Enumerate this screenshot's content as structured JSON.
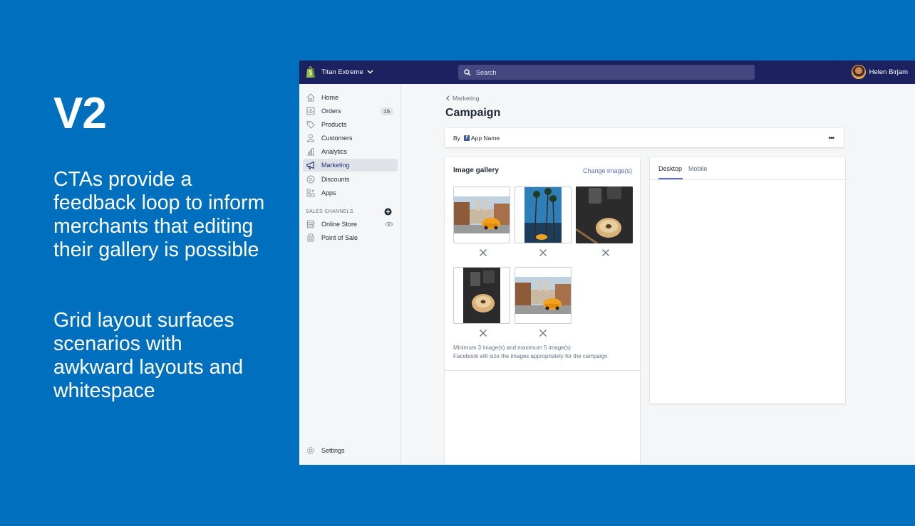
{
  "slide": {
    "title": "V2",
    "paragraph1": "CTAs provide a feedback loop to inform merchants that editing their gallery is possible",
    "paragraph2": "Grid layout surfaces scenarios with awkward layouts and whitespace",
    "background_color": "#0070BE"
  },
  "topbar": {
    "store_name": "Titan Extreme",
    "search_placeholder": "Search",
    "user_name": "Helen Birjam",
    "color": "#1C2260"
  },
  "sidebar": {
    "items": [
      {
        "label": "Home",
        "icon": "home-icon"
      },
      {
        "label": "Orders",
        "icon": "orders-icon",
        "badge": "15"
      },
      {
        "label": "Products",
        "icon": "tag-icon"
      },
      {
        "label": "Customers",
        "icon": "customer-icon"
      },
      {
        "label": "Analytics",
        "icon": "analytics-icon"
      },
      {
        "label": "Marketing",
        "icon": "megaphone-icon",
        "active": true
      },
      {
        "label": "Discounts",
        "icon": "discount-icon"
      },
      {
        "label": "Apps",
        "icon": "apps-icon"
      }
    ],
    "section_label": "SALES CHANNELS",
    "channels": [
      {
        "label": "Online Store",
        "icon": "store-icon"
      },
      {
        "label": "Point of Sale",
        "icon": "pos-icon"
      }
    ],
    "settings_label": "Settings"
  },
  "main": {
    "breadcrumb": "Marketing",
    "title": "Campaign",
    "by_label": "By",
    "app_name": "App Name",
    "more_label": "•••",
    "gallery": {
      "title": "Image gallery",
      "change_link": "Change image(s)",
      "images": [
        "yellow-beetle-street",
        "palm-trees-car",
        "bagel-coffee",
        "bagel-coffee-portrait",
        "yellow-beetle-street"
      ],
      "note_line1": "Minimum 3 image(s) and maximum 5 image(s)",
      "note_line2": "Facebook will size the images appropriately for the campaign"
    },
    "preview": {
      "tabs": [
        "Desktop",
        "Mobile"
      ],
      "active_tab": "Desktop"
    }
  },
  "colors": {
    "accent": "#5C6AC4",
    "text": "#212B36",
    "subdued": "#637381"
  }
}
